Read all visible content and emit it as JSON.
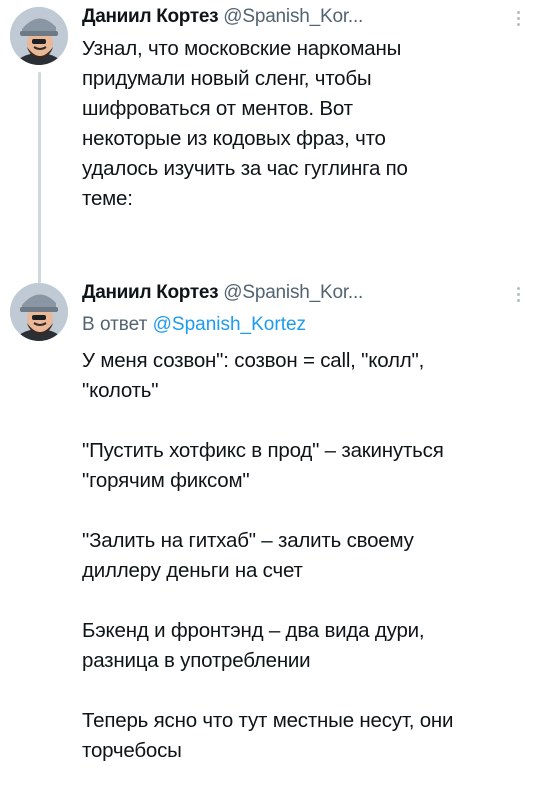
{
  "tweets": [
    {
      "author_name": "Даниил Кортез",
      "author_handle": "@Spanish_Kor...",
      "text_lines": [
        "Узнал, что московские наркоманы",
        "придумали новый сленг, чтобы",
        "шифроваться от ментов. Вот",
        "некоторые из кодовых фраз, что",
        "удалось изучить за час гуглинга по",
        "теме:"
      ]
    },
    {
      "author_name": "Даниил Кортез",
      "author_handle": "@Spanish_Kor...",
      "reply_prefix": "В ответ",
      "reply_mention": "@Spanish_Kortez",
      "paragraphs": [
        [
          "У меня созвон\": созвон = call, \"колл\",",
          "\"колоть\""
        ],
        [
          "\"Пустить хотфикс в прод\" – закинуться",
          "\"горячим фиксом\""
        ],
        [
          "\"Залить на гитхаб\" – залить своему",
          "диллеру деньги на счет"
        ],
        [
          "Бэкенд и фронтэнд – два вида дури,",
          "разница в употреблении"
        ],
        [
          "Теперь ясно что тут местные несут, они",
          "торчебосы"
        ]
      ]
    }
  ],
  "icons": {
    "avatar": "avatar-cartoon-man-with-helmet",
    "more": "more-vertical-icon"
  },
  "colors": {
    "text": "#0f1419",
    "secondary": "#536471",
    "link": "#1d9bf0",
    "thread_line": "#cfd9de"
  }
}
